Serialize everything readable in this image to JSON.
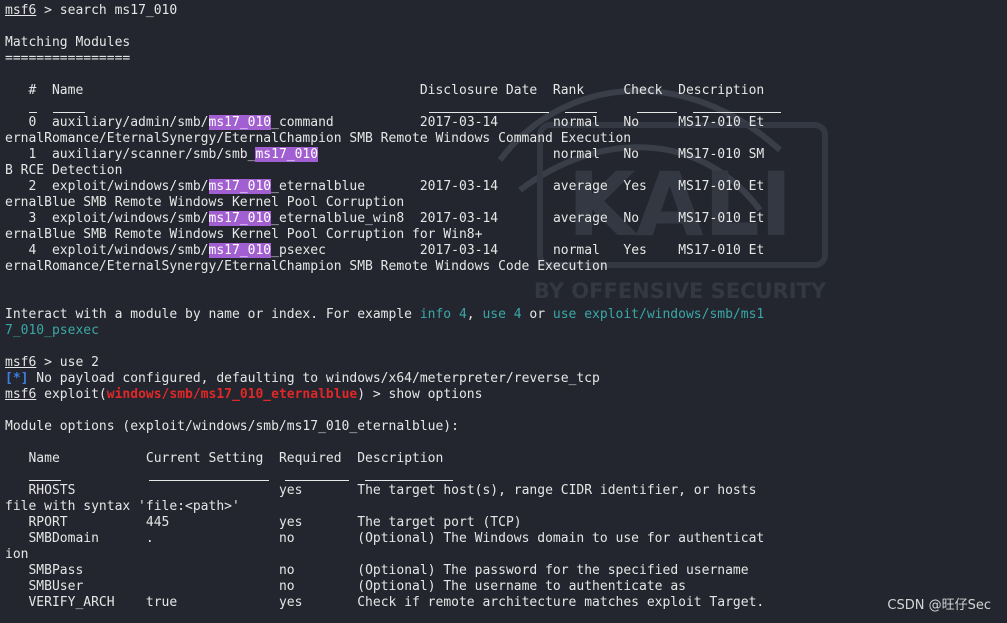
{
  "window": {
    "credit": "CSDN @旺仔Sec"
  },
  "watermark": {
    "brand": "KALI",
    "tagline": "BY OFFENSIVE SECURITY"
  },
  "colors": {
    "background": "#23262e",
    "highlight": "#a25fd1",
    "prompt_red": "#e02828",
    "info_blue": "#3f7fe0",
    "link_teal": "#3aa7a7"
  },
  "prompt": {
    "name": "msf6",
    "sep": " > "
  },
  "search": {
    "cmd": "search ms17_010",
    "title": "Matching Modules",
    "title_rule": "================"
  },
  "modules": {
    "headers": {
      "num": "#",
      "name": "Name",
      "date": "Disclosure Date",
      "rank": "Rank",
      "check": "Check",
      "desc": "Description"
    },
    "rows": [
      {
        "num": "0",
        "pre": "auxiliary/admin/smb/",
        "hl": "ms17_010",
        "post": "_command",
        "date": "2017-03-14",
        "rank": "normal",
        "check": "No",
        "desc": "MS17-010 Et",
        "wrap": "ernalRomance/EternalSynergy/EternalChampion SMB Remote Windows Command Execution"
      },
      {
        "num": "1",
        "pre": "auxiliary/scanner/smb/smb_",
        "hl": "ms17_010",
        "post": "",
        "date": "",
        "rank": "normal",
        "check": "No",
        "desc": "MS17-010 SM",
        "wrap": "B RCE Detection"
      },
      {
        "num": "2",
        "pre": "exploit/windows/smb/",
        "hl": "ms17_010",
        "post": "_eternalblue",
        "date": "2017-03-14",
        "rank": "average",
        "check": "Yes",
        "desc": "MS17-010 Et",
        "wrap": "ernalBlue SMB Remote Windows Kernel Pool Corruption"
      },
      {
        "num": "3",
        "pre": "exploit/windows/smb/",
        "hl": "ms17_010",
        "post": "_eternalblue_win8",
        "date": "2017-03-14",
        "rank": "average",
        "check": "No",
        "desc": "MS17-010 Et",
        "wrap": "ernalBlue SMB Remote Windows Kernel Pool Corruption for Win8+"
      },
      {
        "num": "4",
        "pre": "exploit/windows/smb/",
        "hl": "ms17_010",
        "post": "_psexec",
        "date": "2017-03-14",
        "rank": "normal",
        "check": "Yes",
        "desc": "MS17-010 Et",
        "wrap": "ernalRomance/EternalSynergy/EternalChampion SMB Remote Windows Code Execution"
      }
    ]
  },
  "interact": {
    "text1": "Interact with a module by name or index. For example ",
    "ex1": "info 4",
    "comma": ", ",
    "ex2": "use 4",
    "or": " or ",
    "ex3": "use exploit/windows/smb/ms1",
    "ex3_wrap": "7_010_psexec"
  },
  "use": {
    "cmd": "use 2",
    "info_tag": "[*]",
    "info_text": " No payload configured, defaulting to windows/x64/meterpreter/reverse_tcp",
    "exploit_word": " exploit(",
    "exploit_path": "windows/smb/ms17_010_eternalblue",
    "exploit_close": ")",
    "sep": " > ",
    "cmd2": "show options"
  },
  "options": {
    "title": "Module options (exploit/windows/smb/ms17_010_eternalblue):",
    "headers": {
      "name": "Name",
      "setting": "Current Setting",
      "required": "Required",
      "desc": "Description"
    },
    "rows": [
      {
        "name": "RHOSTS",
        "setting": "",
        "required": "yes",
        "desc": "The target host(s), range CIDR identifier, or hosts",
        "wrap": "file with syntax 'file:<path>'"
      },
      {
        "name": "RPORT",
        "setting": "445",
        "required": "yes",
        "desc": "The target port (TCP)",
        "wrap": ""
      },
      {
        "name": "SMBDomain",
        "setting": ".",
        "required": "no",
        "desc": "(Optional) The Windows domain to use for authenticat",
        "wrap": "ion"
      },
      {
        "name": "SMBPass",
        "setting": "",
        "required": "no",
        "desc": "(Optional) The password for the specified username",
        "wrap": ""
      },
      {
        "name": "SMBUser",
        "setting": "",
        "required": "no",
        "desc": "(Optional) The username to authenticate as",
        "wrap": ""
      },
      {
        "name": "VERIFY_ARCH",
        "setting": "true",
        "required": "yes",
        "desc": "Check if remote architecture matches exploit Target.",
        "wrap": ""
      }
    ]
  }
}
